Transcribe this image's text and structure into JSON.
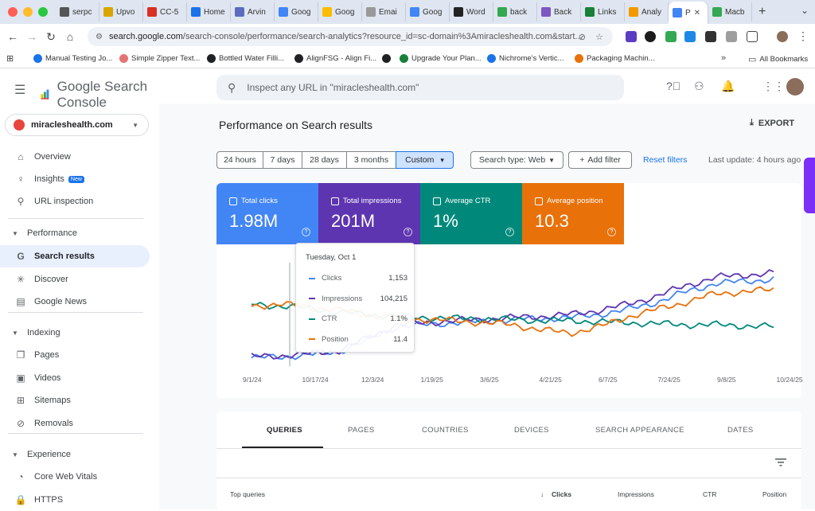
{
  "browser": {
    "tabs": [
      {
        "label": "serpc",
        "color": "#555"
      },
      {
        "label": "Upvo",
        "color": "#d9a400"
      },
      {
        "label": "CC-5",
        "color": "#d93025"
      },
      {
        "label": "Home",
        "color": "#1a73e8"
      },
      {
        "label": "Arvin",
        "color": "#5c6bc0"
      },
      {
        "label": "Goog",
        "color": "#4285f4"
      },
      {
        "label": "Goog",
        "color": "#fbbc04"
      },
      {
        "label": "Emai",
        "color": "#999"
      },
      {
        "label": "Goog",
        "color": "#4285f4"
      },
      {
        "label": "Word",
        "color": "#222"
      },
      {
        "label": "back",
        "color": "#34a853"
      },
      {
        "label": "Back",
        "color": "#7e57c2"
      },
      {
        "label": "Links",
        "color": "#188038"
      },
      {
        "label": "Analy",
        "color": "#f29900"
      },
      {
        "label": "P",
        "color": "#4285f4"
      },
      {
        "label": "Macb",
        "color": "#34a853"
      }
    ],
    "active_tab_index": 14,
    "url_host": "search.google.com",
    "url_path": "/search-console/performance/search-analytics?resource_id=sc-domain%3Amiracleshealth.com&start...",
    "bookmarks": [
      {
        "label": "Manual Testing Jo...",
        "color": "#1a73e8"
      },
      {
        "label": "Simple Zipper Text...",
        "color": "#e57373"
      },
      {
        "label": "Bottled Water Filli...",
        "color": "#202124"
      },
      {
        "label": "AlignFSG - Align Fi...",
        "color": "#202124"
      },
      {
        "label": "",
        "color": "#202124"
      },
      {
        "label": "Upgrade Your Plan...",
        "color": "#188038"
      },
      {
        "label": "Nichrome's Vertic...",
        "color": "#1a73e8"
      },
      {
        "label": "Packaging Machin...",
        "color": "#e8710a"
      }
    ],
    "all_bookmarks": "All Bookmarks"
  },
  "app": {
    "name": "Google Search Console",
    "search_placeholder": "Inspect any URL in \"miracleshealth.com\"",
    "property": "miracleshealth.com"
  },
  "sidebar": {
    "items": [
      {
        "label": "Overview",
        "icon": "home-icon",
        "glyph": "⌂"
      },
      {
        "label": "Insights",
        "icon": "lightbulb-icon",
        "glyph": "♀",
        "badge": "New"
      },
      {
        "label": "URL inspection",
        "icon": "search-icon",
        "glyph": "⚲"
      }
    ],
    "performance_header": "Performance",
    "performance_items": [
      {
        "label": "Search results",
        "icon": "google-g-icon",
        "glyph": "G"
      },
      {
        "label": "Discover",
        "icon": "discover-icon",
        "glyph": "✳"
      },
      {
        "label": "Google News",
        "icon": "news-icon",
        "glyph": "▤"
      }
    ],
    "indexing_header": "Indexing",
    "indexing_items": [
      {
        "label": "Pages",
        "icon": "pages-icon",
        "glyph": "❐"
      },
      {
        "label": "Videos",
        "icon": "videos-icon",
        "glyph": "▣"
      },
      {
        "label": "Sitemaps",
        "icon": "sitemaps-icon",
        "glyph": "⊞"
      },
      {
        "label": "Removals",
        "icon": "removals-icon",
        "glyph": "⊘"
      }
    ],
    "experience_header": "Experience",
    "experience_items": [
      {
        "label": "Core Web Vitals",
        "icon": "speedometer-icon",
        "glyph": "◔"
      },
      {
        "label": "HTTPS",
        "icon": "lock-icon",
        "glyph": "🔒"
      }
    ]
  },
  "page": {
    "title": "Performance on Search results",
    "export": "EXPORT",
    "date_chips": [
      "24 hours",
      "7 days",
      "28 days",
      "3 months",
      "Custom"
    ],
    "selected_chip": "Custom",
    "search_type": "Search type: Web",
    "add_filter": "Add filter",
    "reset_filters": "Reset filters",
    "last_update": "Last update: 4 hours ago"
  },
  "metrics": [
    {
      "label": "Total clicks",
      "value": "1.98M",
      "color": "#4285f4"
    },
    {
      "label": "Total impressions",
      "value": "201M",
      "color": "#5e35b1"
    },
    {
      "label": "Average CTR",
      "value": "1%",
      "color": "#00897b"
    },
    {
      "label": "Average position",
      "value": "10.3",
      "color": "#e8710a"
    }
  ],
  "tooltip": {
    "date": "Tuesday, Oct 1",
    "rows": [
      {
        "label": "Clicks",
        "value": "1,153",
        "color": "#4285f4"
      },
      {
        "label": "Impressions",
        "value": "104,215",
        "color": "#5e35b1"
      },
      {
        "label": "CTR",
        "value": "1.1%",
        "color": "#00897b"
      },
      {
        "label": "Position",
        "value": "11.4",
        "color": "#e8710a"
      }
    ]
  },
  "chart_data": {
    "type": "line",
    "x_ticks": [
      "9/1/24",
      "10/17/24",
      "12/3/24",
      "1/19/25",
      "3/6/25",
      "4/21/25",
      "6/7/25",
      "7/24/25",
      "9/8/25",
      "10/24/25"
    ],
    "series": [
      {
        "name": "Clicks",
        "color": "#4285f4",
        "values": [
          8,
          9,
          11,
          14,
          25,
          38,
          40,
          42,
          43,
          45,
          46,
          47,
          50,
          55,
          62,
          72,
          80,
          82,
          84
        ]
      },
      {
        "name": "Impressions",
        "color": "#5e35b1",
        "values": [
          9,
          10,
          12,
          15,
          27,
          40,
          42,
          44,
          45,
          47,
          48,
          50,
          54,
          60,
          68,
          78,
          86,
          88,
          90
        ]
      },
      {
        "name": "CTR",
        "color": "#00897b",
        "values": [
          60,
          58,
          56,
          52,
          50,
          48,
          47,
          46,
          46,
          45,
          44,
          44,
          43,
          42,
          41,
          40,
          40,
          39,
          38
        ]
      },
      {
        "name": "Position",
        "color": "#e8710a",
        "values": [
          58,
          60,
          57,
          54,
          50,
          46,
          45,
          44,
          42,
          40,
          35,
          32,
          38,
          48,
          55,
          62,
          70,
          72,
          74
        ]
      }
    ]
  },
  "table": {
    "tabs": [
      "QUERIES",
      "PAGES",
      "COUNTRIES",
      "DEVICES",
      "SEARCH APPEARANCE",
      "DATES"
    ],
    "active_tab": "QUERIES",
    "headers": [
      "Top queries",
      "Clicks",
      "Impressions",
      "CTR",
      "Position"
    ]
  }
}
